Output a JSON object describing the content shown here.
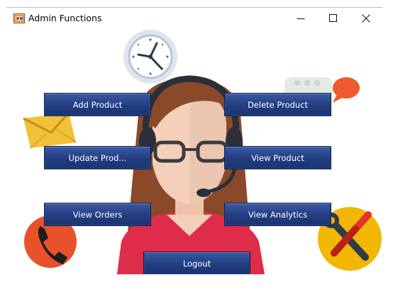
{
  "window": {
    "title": "Admin Functions",
    "icon": "app-window-icon",
    "controls": [
      "minimize-icon",
      "maximize-icon",
      "close-icon"
    ]
  },
  "buttons": {
    "add_product": "Add Product",
    "delete_product": "Delete Product",
    "update_product": "Update Prod...",
    "view_product": "View Product",
    "view_orders": "View Orders",
    "view_analytics": "View Analytics",
    "logout": "Logout"
  },
  "colors": {
    "button_fill": "#223d80",
    "button_text": "#ffffff",
    "hair": "#8a4a2a",
    "shirt": "#e02c4b",
    "phone_circle": "#e8522a",
    "tools_circle": "#f2b705",
    "envelope": "#f3c139"
  },
  "background_illustration": "support-agent-headset"
}
